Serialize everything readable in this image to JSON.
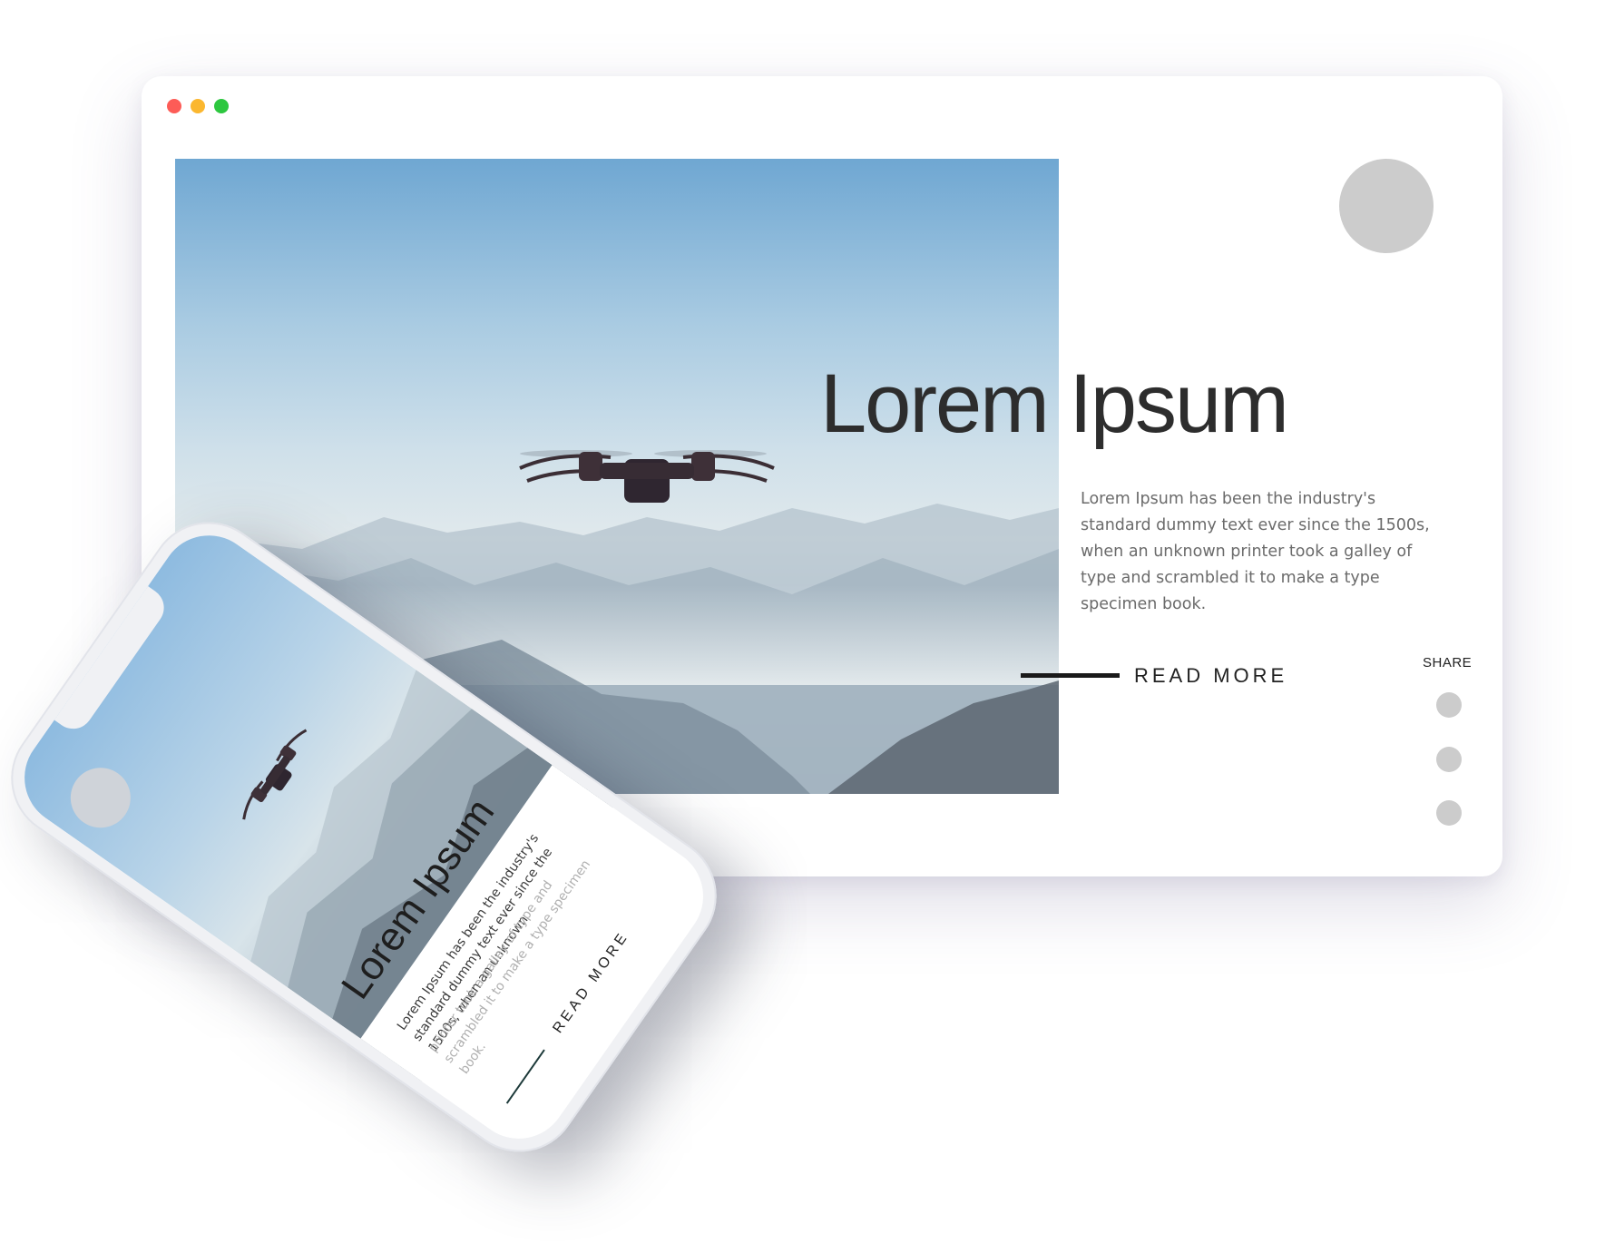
{
  "window": {
    "controls": [
      "close",
      "minimize",
      "maximize"
    ],
    "colors": {
      "close": "#fd5c57",
      "minimize": "#fbb72f",
      "maximize": "#2dc73f"
    }
  },
  "desktop": {
    "hero_image": "drone-over-misty-mountains",
    "title": "Lorem Ipsum",
    "description": "Lorem Ipsum has been the industry's standard dummy text ever since the 1500s, when an unknown printer took a galley of type and scrambled it to make a type specimen book.",
    "read_more": "READ MORE",
    "share_label": "SHARE",
    "share_icons": [
      "share-icon-1",
      "share-icon-2",
      "share-icon-3"
    ]
  },
  "mobile": {
    "hero_image": "drone-over-misty-mountains",
    "title": "Lorem Ipsum",
    "description_dark": "Lorem Ipsum has been the industry's standard dummy text ever since the 1500s, when an unknown",
    "description_faded": "printer took a galley of type and scrambled it to make a type specimen book.",
    "read_more": "READ MORE"
  },
  "colors": {
    "title": "#2d2d2d",
    "body_text": "#6b6b6b",
    "placeholder_circle": "#cccccc",
    "accent_line": "#1a1a1a"
  }
}
